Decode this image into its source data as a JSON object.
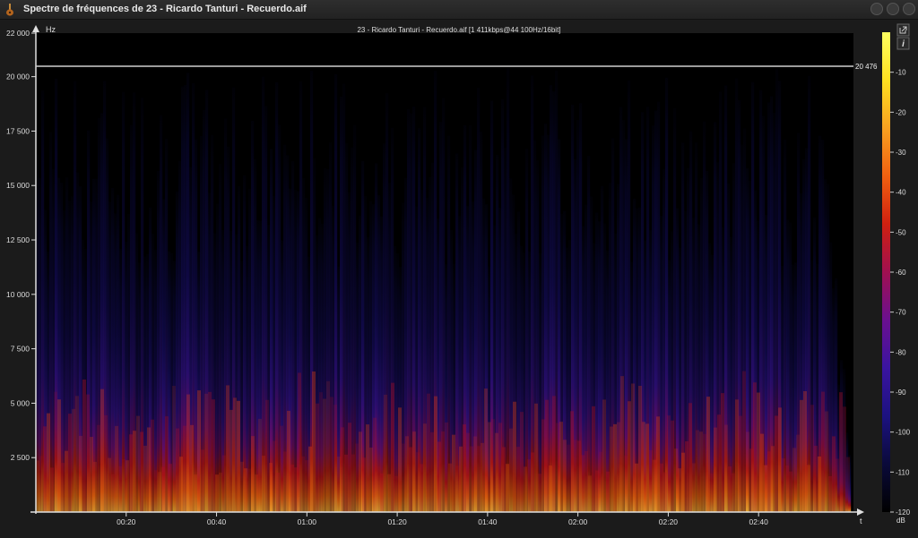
{
  "window": {
    "title": "Spectre de fréquences de 23 - Ricardo Tanturi - Recuerdo.aif",
    "icon": "guitar-icon"
  },
  "window_controls": [
    {
      "name": "minimize-button",
      "glyph": "●"
    },
    {
      "name": "maximize-button",
      "glyph": "●"
    },
    {
      "name": "close-button",
      "glyph": "●"
    }
  ],
  "side_icons": {
    "export": "external-link-icon",
    "info": "info-icon",
    "info_glyph": "i"
  },
  "chart_data": {
    "type": "heatmap",
    "title": "23 - Ricardo Tanturi - Recuerdo.aif [1 411kbps@44 100Hz/16bit]",
    "ylabel": "Hz",
    "xlabel": "t",
    "ylim": [
      0,
      22000
    ],
    "xlim_seconds": [
      0,
      181
    ],
    "y_ticks": [
      {
        "value": 22000,
        "label": "22 000"
      },
      {
        "value": 20000,
        "label": "20 000"
      },
      {
        "value": 17500,
        "label": "17 500"
      },
      {
        "value": 15000,
        "label": "15 000"
      },
      {
        "value": 12500,
        "label": "12 500"
      },
      {
        "value": 10000,
        "label": "10 000"
      },
      {
        "value": 7500,
        "label": "7 500"
      },
      {
        "value": 5000,
        "label": "5 000"
      },
      {
        "value": 2500,
        "label": "2 500"
      }
    ],
    "x_ticks": [
      {
        "value": 20,
        "label": "00:20"
      },
      {
        "value": 40,
        "label": "00:40"
      },
      {
        "value": 60,
        "label": "01:00"
      },
      {
        "value": 80,
        "label": "01:20"
      },
      {
        "value": 100,
        "label": "01:40"
      },
      {
        "value": 120,
        "label": "02:00"
      },
      {
        "value": 140,
        "label": "02:20"
      },
      {
        "value": 160,
        "label": "02:40"
      }
    ],
    "cutoff": {
      "value": 20476,
      "label": "20 476"
    },
    "colorbar": {
      "unit": "dB",
      "range": [
        -120,
        0
      ],
      "ticks": [
        {
          "value": -10,
          "label": "-10"
        },
        {
          "value": -20,
          "label": "-20"
        },
        {
          "value": -30,
          "label": "-30"
        },
        {
          "value": -40,
          "label": "-40"
        },
        {
          "value": -50,
          "label": "-50"
        },
        {
          "value": -60,
          "label": "-60"
        },
        {
          "value": -70,
          "label": "-70"
        },
        {
          "value": -80,
          "label": "-80"
        },
        {
          "value": -90,
          "label": "-90"
        },
        {
          "value": -100,
          "label": "-100"
        },
        {
          "value": -110,
          "label": "-110"
        },
        {
          "value": -120,
          "label": "-120"
        }
      ],
      "colors": [
        "#000000",
        "#0a0a3a",
        "#1c1280",
        "#3a14a0",
        "#6a1090",
        "#a01050",
        "#d02010",
        "#f06010",
        "#f8a020",
        "#ffe020",
        "#ffff60"
      ]
    }
  }
}
